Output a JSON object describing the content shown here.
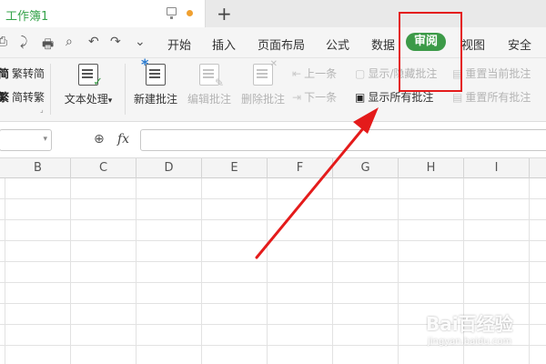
{
  "tab": {
    "title": "工作簿1",
    "new_tab": "+"
  },
  "quick_access": [
    "⎙",
    "⤸",
    "🖶",
    "⌕",
    "↶",
    "↷",
    "⌄"
  ],
  "menu": {
    "items": [
      "开始",
      "插入",
      "页面布局",
      "公式",
      "数据",
      "审阅",
      "视图",
      "安全"
    ],
    "active": "审阅"
  },
  "ribbon": {
    "chinese_conversion": {
      "trad_to_simp": "繁转简",
      "simp_to_trad": "简转繁"
    },
    "text_processing": {
      "label": "文本处理",
      "caret": "▾"
    },
    "comments": {
      "new": "新建批注",
      "edit": "编辑批注",
      "delete": "删除批注",
      "previous": "上一条",
      "next": "下一条",
      "show_hide": "显示/隐藏批注",
      "show_all": "显示所有批注",
      "reset_current": "重置当前批注",
      "reset_all": "重置所有批注"
    }
  },
  "formula_bar": {
    "fx": "fx",
    "zoom_icon": "⊕",
    "name_caret": "▾"
  },
  "columns": [
    "B",
    "C",
    "D",
    "E",
    "F",
    "G",
    "H",
    "I"
  ],
  "watermark": {
    "main": "Bai百经验",
    "sub": "jingyan.baidu.com"
  },
  "colors": {
    "accent": "#3c9a48",
    "highlight": "#e41b1b",
    "arrow": "#e41b1b",
    "title": "#35a34a"
  }
}
